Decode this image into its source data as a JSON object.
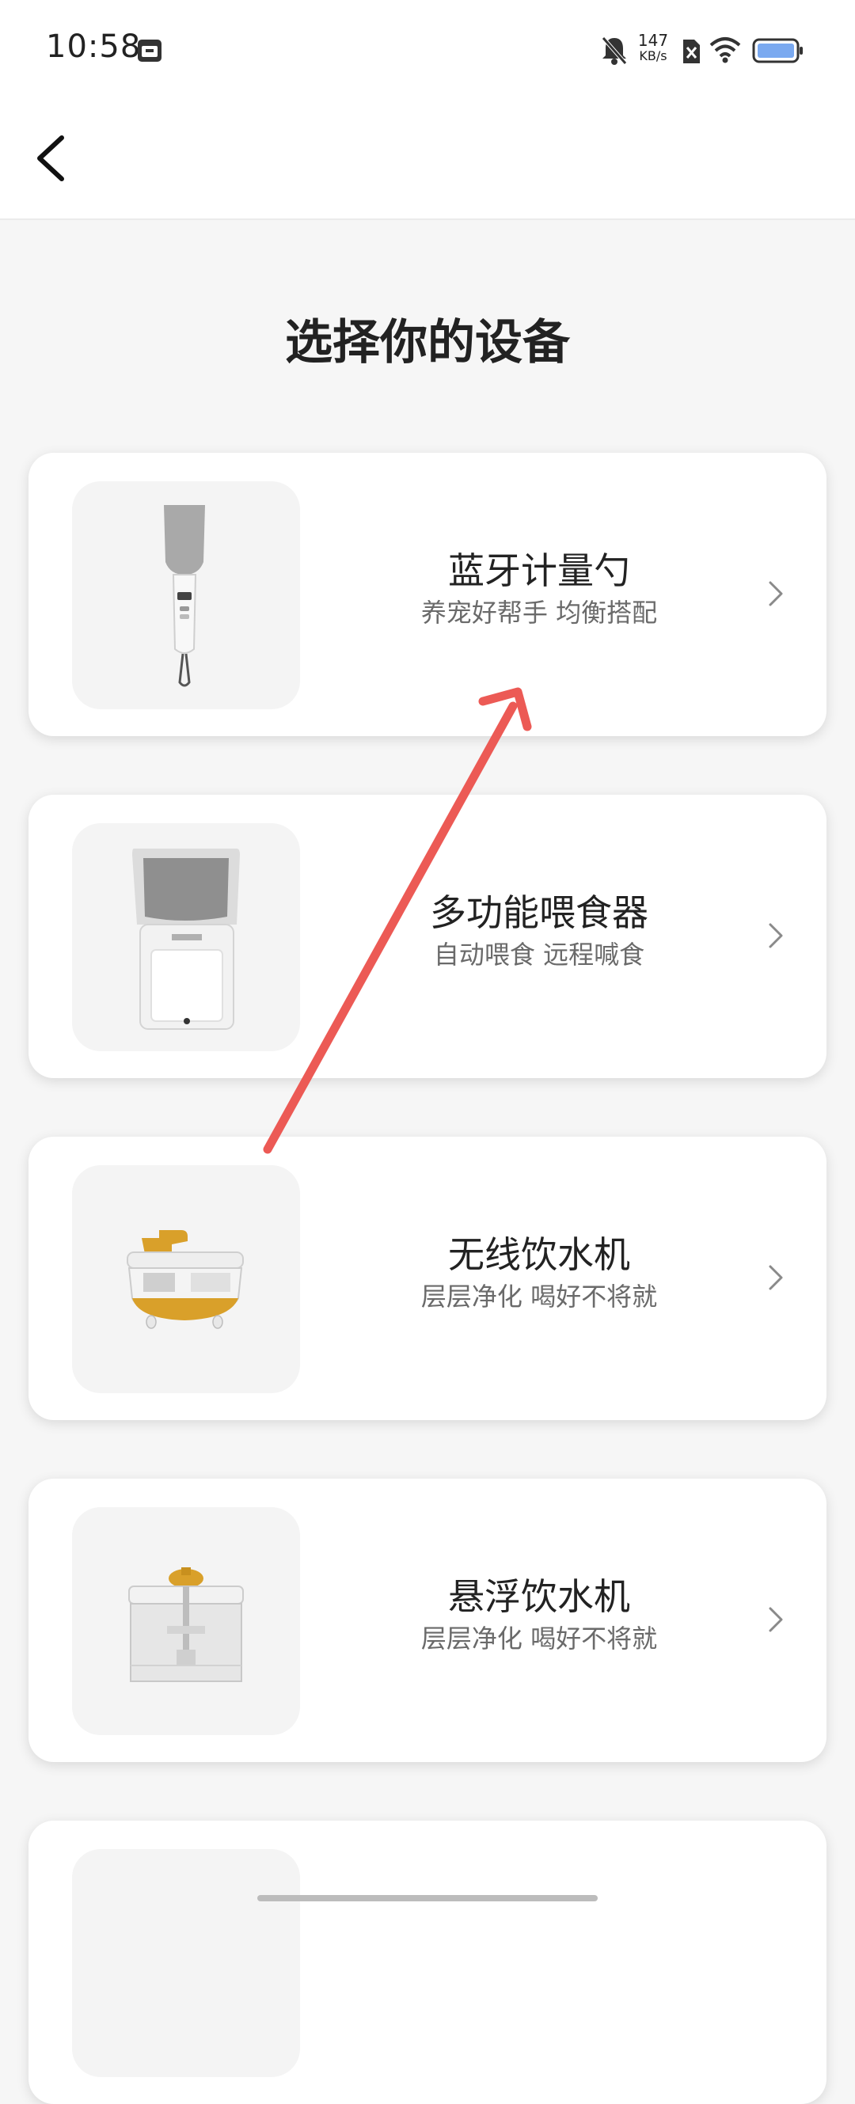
{
  "status_bar": {
    "time": "10:58",
    "net_speed_value": "147",
    "net_speed_unit": "KB/s",
    "icons": [
      "calendar-app-icon",
      "mute-bell-icon",
      "sim-disabled-icon",
      "wifi-icon",
      "battery-icon"
    ]
  },
  "app_bar": {
    "back_icon": "chevron-left-icon"
  },
  "page": {
    "title": "选择你的设备"
  },
  "devices": [
    {
      "name": "蓝牙计量勺",
      "desc": "养宠好帮手 均衡搭配",
      "image": "measuring-spoon-image"
    },
    {
      "name": "多功能喂食器",
      "desc": "自动喂食 远程喊食",
      "image": "feeder-image"
    },
    {
      "name": "无线饮水机",
      "desc": "层层净化 喝好不将就",
      "image": "wireless-fountain-image"
    },
    {
      "name": "悬浮饮水机",
      "desc": "层层净化 喝好不将就",
      "image": "floating-fountain-image"
    },
    {
      "name": "",
      "desc": "",
      "image": ""
    }
  ],
  "colors": {
    "background": "#f6f6f6",
    "card": "#ffffff",
    "arrow": "#ec5a55",
    "fountain_accent": "#d9a02a"
  }
}
